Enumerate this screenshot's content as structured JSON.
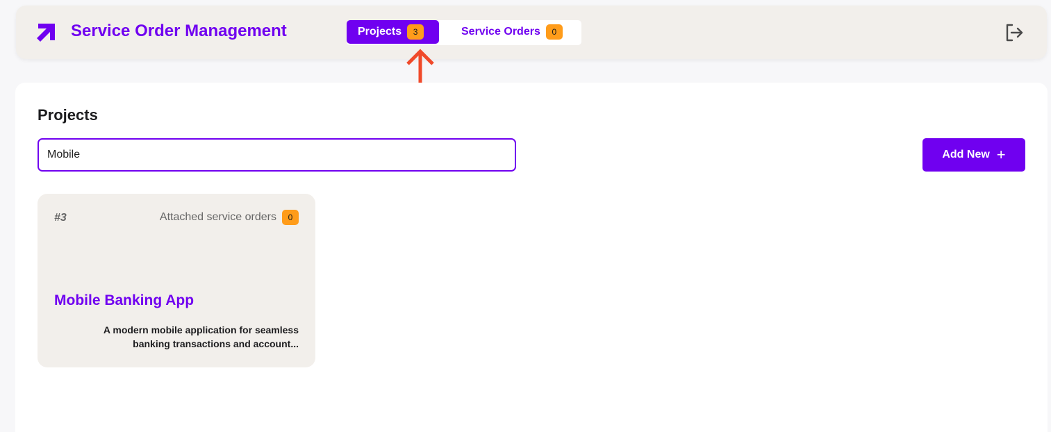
{
  "header": {
    "app_title": "Service Order Management",
    "tabs": [
      {
        "label": "Projects",
        "count": "3",
        "active": true
      },
      {
        "label": "Service Orders",
        "count": "0",
        "active": false
      }
    ]
  },
  "main": {
    "title": "Projects",
    "search": {
      "value": "Mobile"
    },
    "add_button_label": "Add New",
    "add_button_icon": "+"
  },
  "cards": [
    {
      "id": "#3",
      "attached_label": "Attached service orders",
      "attached_count": "0",
      "title": "Mobile Banking App",
      "description": "A modern mobile application for seamless banking transactions and account..."
    }
  ],
  "colors": {
    "accent": "#7000f0",
    "badge": "#ff9c1a",
    "header_bg": "#f2efeb",
    "annotation_arrow": "#f04a2a"
  },
  "icons": {
    "logo": "arrow-up-right-icon",
    "logout": "logout-icon",
    "annotation": "up-arrow-annotation"
  }
}
